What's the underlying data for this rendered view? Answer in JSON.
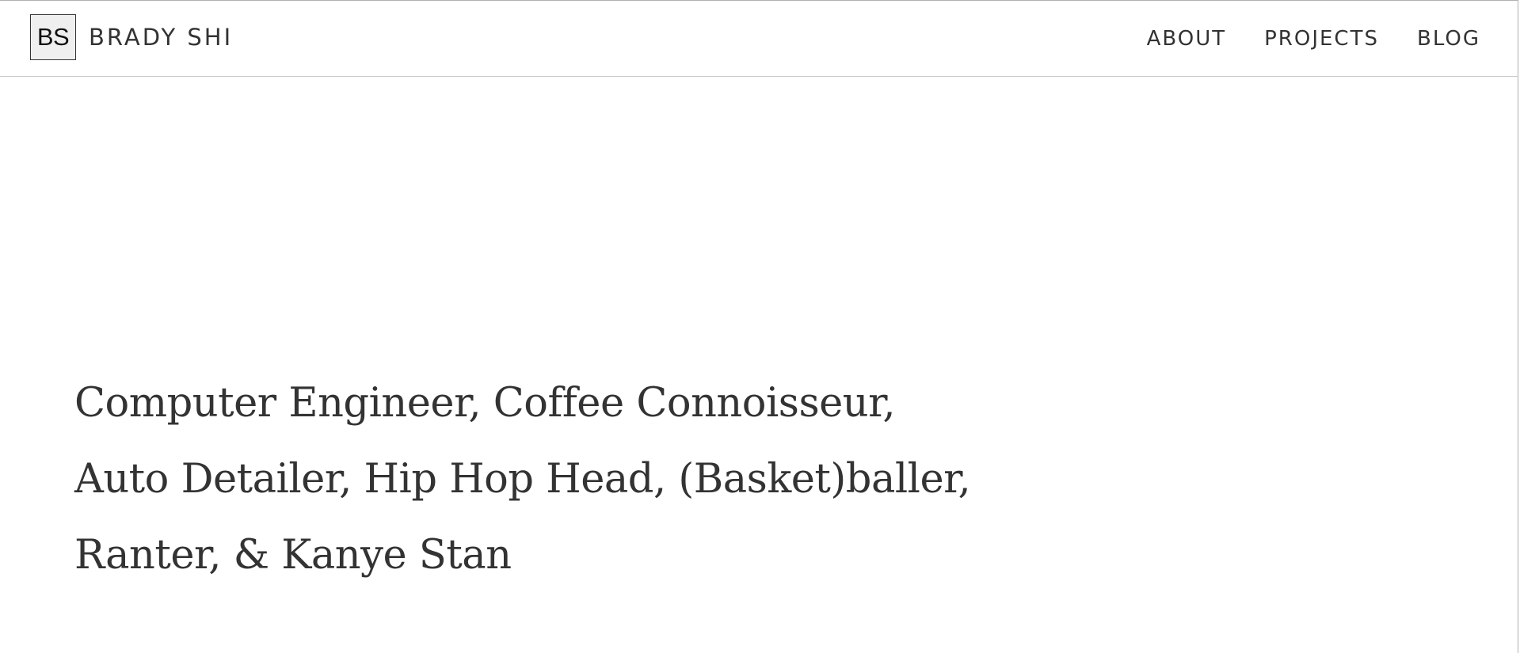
{
  "brand": {
    "logo_text": "BS",
    "name": "BRADY SHI"
  },
  "nav": {
    "items": [
      {
        "label": "ABOUT"
      },
      {
        "label": "PROJECTS"
      },
      {
        "label": "BLOG"
      }
    ]
  },
  "hero": {
    "lines": [
      "Computer Engineer, Coffee Connoisseur,",
      "Auto Detailer, Hip Hop Head, (Basket)baller,",
      "Ranter, & Kanye Stan"
    ]
  },
  "colors": {
    "text": "#333333",
    "background": "#ffffff",
    "logo_background": "#efefef",
    "divider": "#c8c8c8"
  }
}
